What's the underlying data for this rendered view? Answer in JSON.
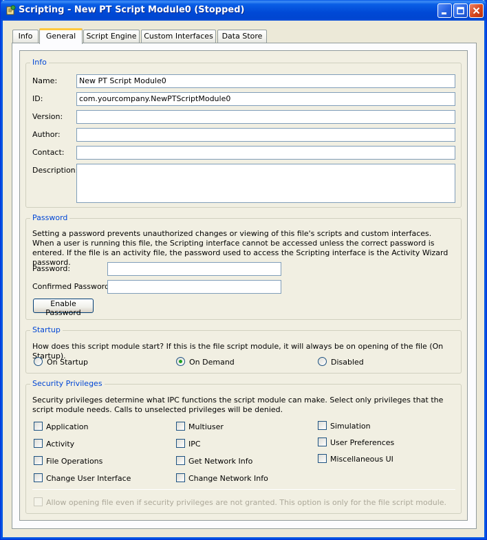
{
  "window": {
    "title": "Scripting - New PT Script Module0 (Stopped)"
  },
  "tabs": [
    {
      "label": "Info"
    },
    {
      "label": "General"
    },
    {
      "label": "Script Engine"
    },
    {
      "label": "Custom Interfaces"
    },
    {
      "label": "Data Store"
    }
  ],
  "info": {
    "legend": "Info",
    "name_label": "Name:",
    "name_value": "New PT Script Module0",
    "id_label": "ID:",
    "id_value": "com.yourcompany.NewPTScriptModule0",
    "version_label": "Version:",
    "version_value": "",
    "author_label": "Author:",
    "author_value": "",
    "contact_label": "Contact:",
    "contact_value": "",
    "description_label": "Description:",
    "description_value": ""
  },
  "password": {
    "legend": "Password",
    "description": "Setting a password prevents unauthorized changes or viewing of this file's scripts and custom interfaces. When a user is running this file, the Scripting interface cannot be accessed unless the correct password is entered.  If the file is an activity file, the password used to access the Scripting interface is the Activity Wizard password.",
    "password_label": "Password:",
    "confirmed_label": "Confirmed Password:",
    "enable_button": "Enable Password"
  },
  "startup": {
    "legend": "Startup",
    "question": "How does this script module start?  If this is the file script module, it will always be on opening of the file (On Startup).",
    "options": [
      {
        "label": "On Startup",
        "selected": false
      },
      {
        "label": "On Demand",
        "selected": true
      },
      {
        "label": "Disabled",
        "selected": false
      }
    ]
  },
  "security": {
    "legend": "Security Privileges",
    "description": "Security privileges determine what IPC functions the script module can make. Select only privileges that the script module needs. Calls to unselected privileges will be denied.",
    "col1": [
      {
        "label": "Application",
        "checked": false
      },
      {
        "label": "Activity",
        "checked": false
      },
      {
        "label": "File Operations",
        "checked": false
      },
      {
        "label": "Change User Interface",
        "checked": false
      }
    ],
    "col2": [
      {
        "label": "Multiuser",
        "checked": false
      },
      {
        "label": "IPC",
        "checked": false
      },
      {
        "label": "Get Network Info",
        "checked": false
      },
      {
        "label": "Change Network Info",
        "checked": false
      }
    ],
    "col3": [
      {
        "label": "Simulation",
        "checked": false
      },
      {
        "label": "User Preferences",
        "checked": false
      },
      {
        "label": "Miscellaneous UI",
        "checked": false
      }
    ],
    "allow_label": "Allow opening file even if security privileges are not granted. This option is only for the file script module."
  },
  "colors": {
    "title_bar": "#0054e3",
    "legend_text": "#0046d5",
    "active_tab_accent": "#ffc83c",
    "radio_dot": "#21a121"
  }
}
